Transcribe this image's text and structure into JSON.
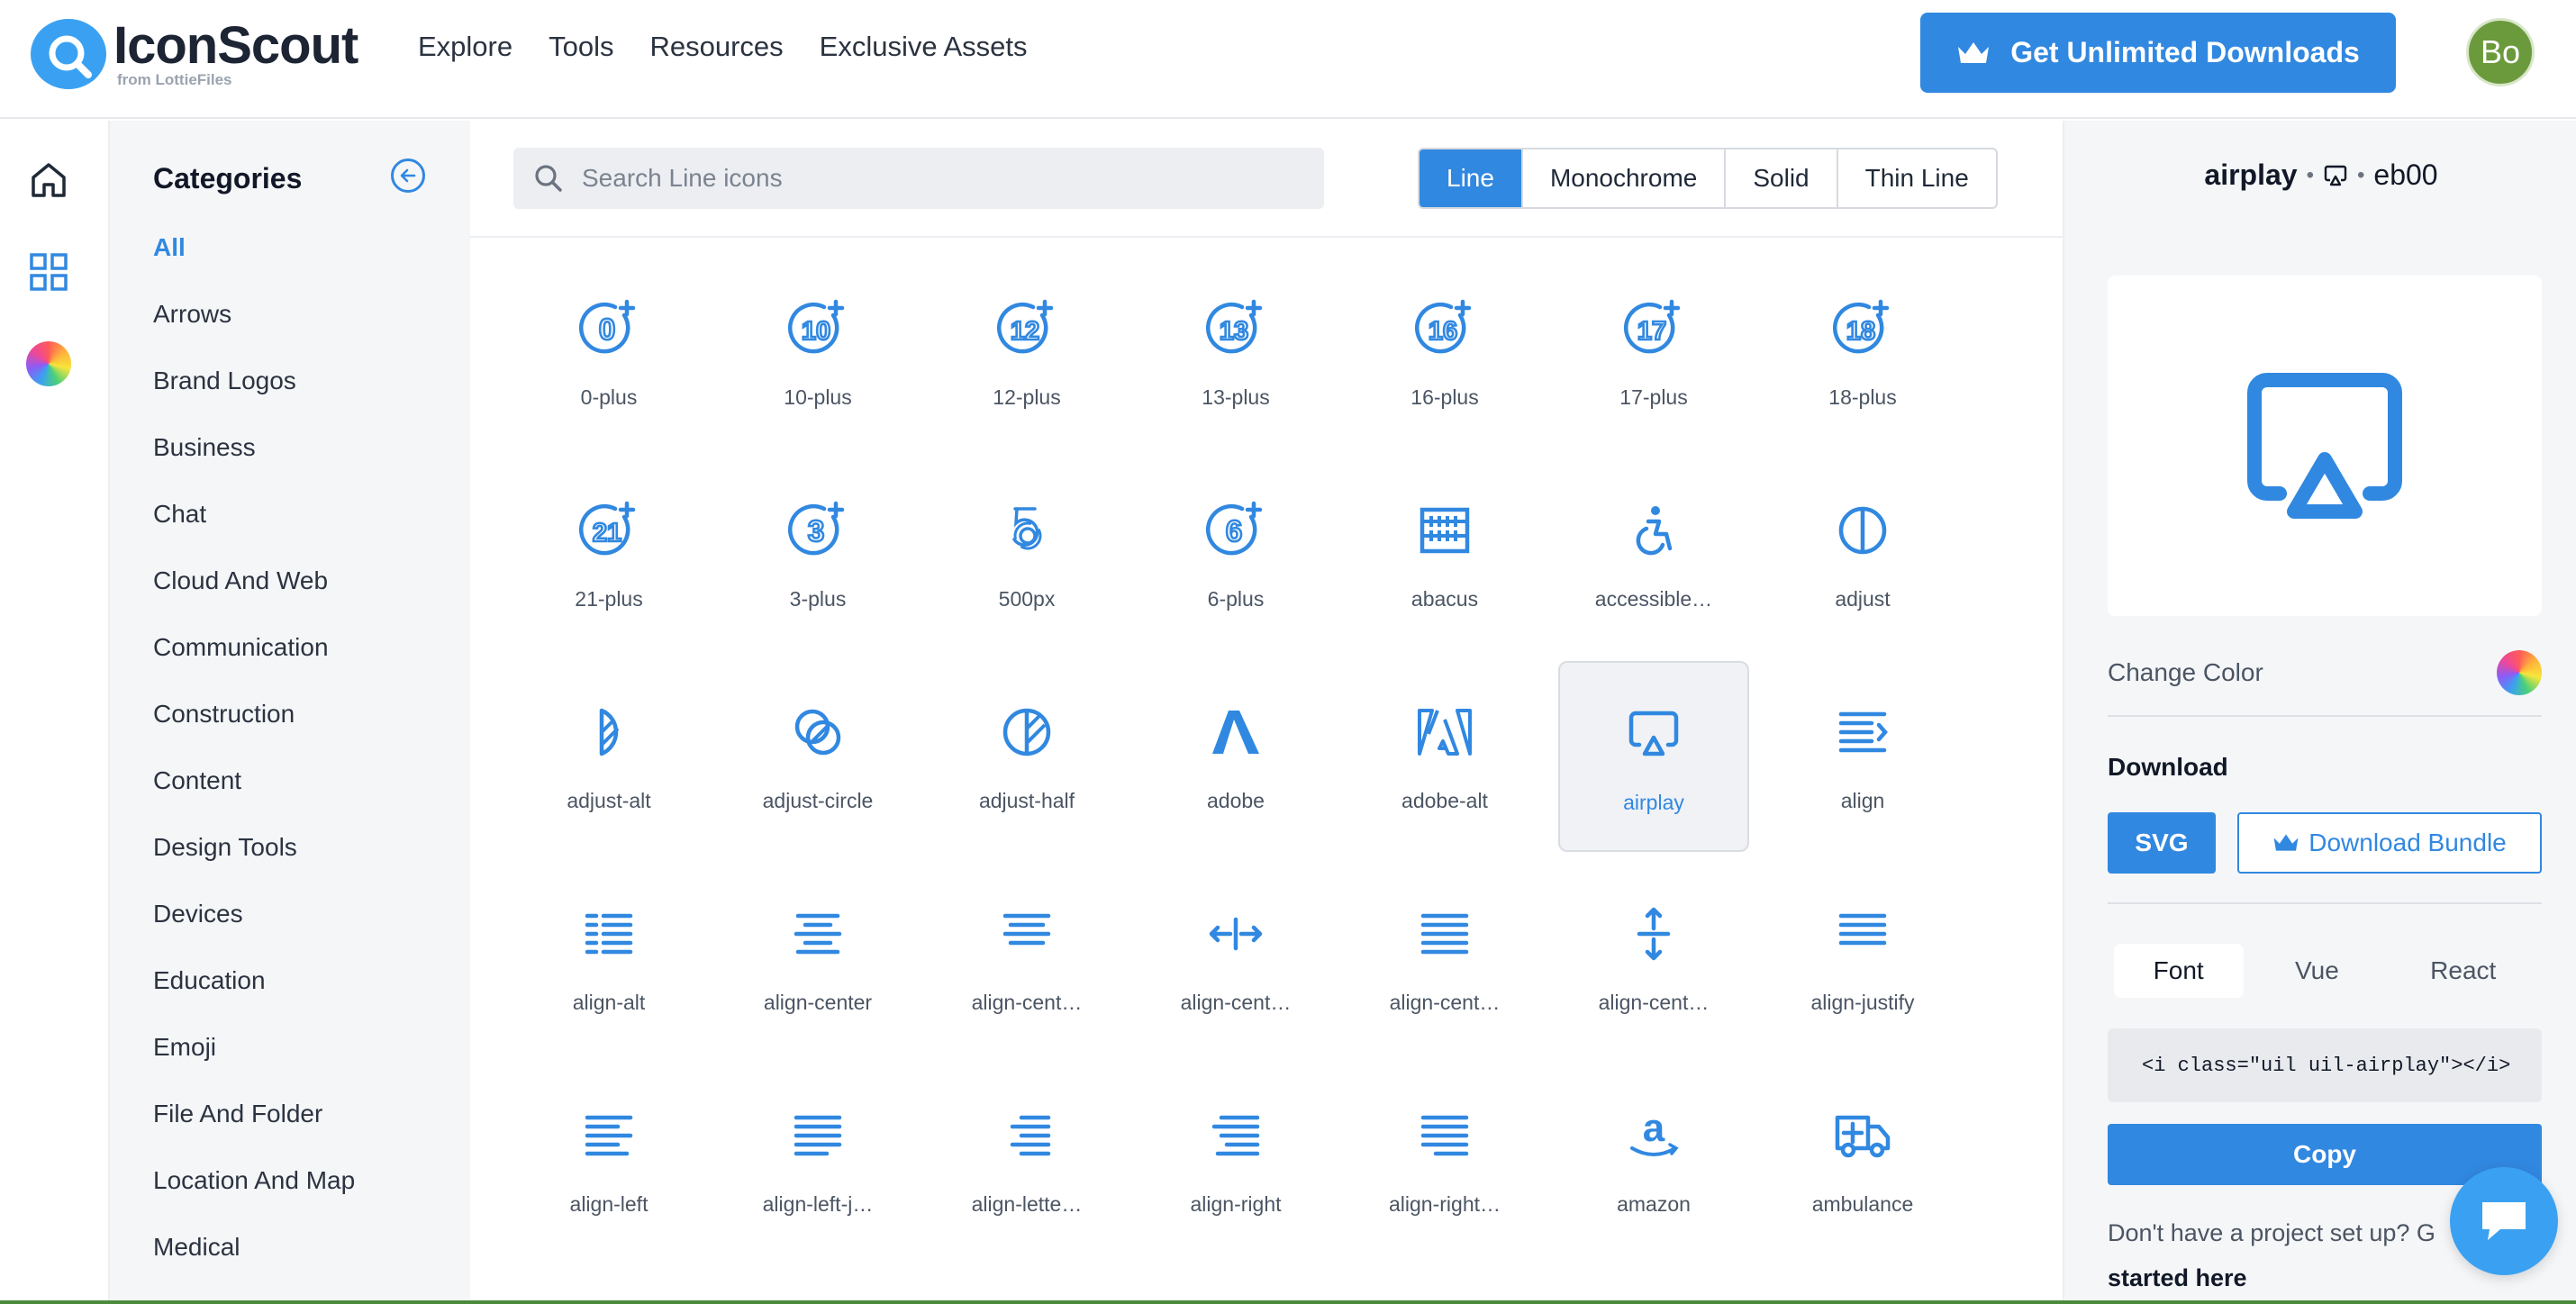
{
  "brand": {
    "name": "IconScout",
    "tagline": "from LottieFiles"
  },
  "nav": [
    "Explore",
    "Tools",
    "Resources",
    "Exclusive Assets"
  ],
  "cta": {
    "label": "Get Unlimited Downloads"
  },
  "user": {
    "initials": "Bo"
  },
  "categories": {
    "title": "Categories",
    "items": [
      "All",
      "Arrows",
      "Brand Logos",
      "Business",
      "Chat",
      "Cloud And Web",
      "Communication",
      "Construction",
      "Content",
      "Design Tools",
      "Devices",
      "Education",
      "Emoji",
      "File And Folder",
      "Location And Map",
      "Medical"
    ],
    "active": "All"
  },
  "search": {
    "placeholder": "Search Line icons"
  },
  "style_tabs": [
    "Line",
    "Monochrome",
    "Solid",
    "Thin Line"
  ],
  "active_style": "Line",
  "icons": [
    {
      "label": "0-plus",
      "icon": "0-plus-icon"
    },
    {
      "label": "10-plus",
      "icon": "10-plus-icon"
    },
    {
      "label": "12-plus",
      "icon": "12-plus-icon"
    },
    {
      "label": "13-plus",
      "icon": "13-plus-icon"
    },
    {
      "label": "16-plus",
      "icon": "16-plus-icon"
    },
    {
      "label": "17-plus",
      "icon": "17-plus-icon"
    },
    {
      "label": "18-plus",
      "icon": "18-plus-icon"
    },
    {
      "label": "21-plus",
      "icon": "21-plus-icon"
    },
    {
      "label": "3-plus",
      "icon": "3-plus-icon"
    },
    {
      "label": "500px",
      "icon": "500px-icon"
    },
    {
      "label": "6-plus",
      "icon": "6-plus-icon"
    },
    {
      "label": "abacus",
      "icon": "abacus-icon"
    },
    {
      "label": "accessible…",
      "icon": "accessible-icon"
    },
    {
      "label": "adjust",
      "icon": "adjust-icon"
    },
    {
      "label": "adjust-alt",
      "icon": "adjust-alt-icon"
    },
    {
      "label": "adjust-circle",
      "icon": "adjust-circle-icon"
    },
    {
      "label": "adjust-half",
      "icon": "adjust-half-icon"
    },
    {
      "label": "adobe",
      "icon": "adobe-icon"
    },
    {
      "label": "adobe-alt",
      "icon": "adobe-alt-icon"
    },
    {
      "label": "airplay",
      "icon": "airplay-icon"
    },
    {
      "label": "align",
      "icon": "align-icon"
    },
    {
      "label": "align-alt",
      "icon": "align-alt-icon"
    },
    {
      "label": "align-center",
      "icon": "align-center-icon"
    },
    {
      "label": "align-cent…",
      "icon": "align-center-alt-icon"
    },
    {
      "label": "align-cent…",
      "icon": "align-center-h-icon"
    },
    {
      "label": "align-cent…",
      "icon": "align-center-justify-icon"
    },
    {
      "label": "align-cent…",
      "icon": "align-center-v-icon"
    },
    {
      "label": "align-justify",
      "icon": "align-justify-icon"
    },
    {
      "label": "align-left",
      "icon": "align-left-icon"
    },
    {
      "label": "align-left-j…",
      "icon": "align-left-justify-icon"
    },
    {
      "label": "align-lette…",
      "icon": "align-letter-rtl-icon"
    },
    {
      "label": "align-right",
      "icon": "align-right-icon"
    },
    {
      "label": "align-right…",
      "icon": "align-right-justify-icon"
    },
    {
      "label": "amazon",
      "icon": "amazon-icon"
    },
    {
      "label": "ambulance",
      "icon": "ambulance-icon"
    }
  ],
  "selected_icon": "airplay",
  "panel": {
    "name": "airplay",
    "sep": "•",
    "code": "eb00",
    "change_color": "Change Color",
    "download_title": "Download",
    "svg_label": "SVG",
    "bundle_label": "Download Bundle",
    "framework_tabs": [
      "Font",
      "Vue",
      "React"
    ],
    "active_framework": "Font",
    "snippet": "<i class=\"uil uil-airplay\"></i>",
    "copy_label": "Copy",
    "footnote_text": "Don't have a project set up? G",
    "footnote_link": "started here"
  },
  "colors": {
    "accent": "#3188e0",
    "panel_bg": "#f5f6f8",
    "brand_blue": "#3aa1f2"
  }
}
